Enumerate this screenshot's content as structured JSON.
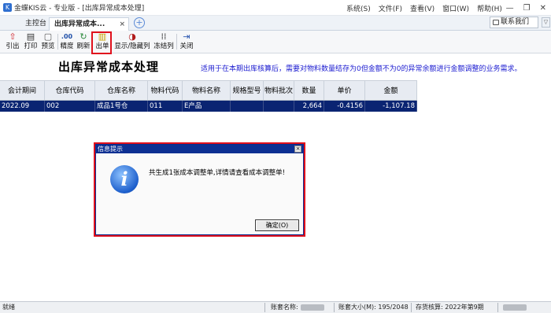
{
  "window": {
    "app_logo": "K",
    "title": "金蝶KIS云 - 专业版 - [出库异常成本处理]",
    "menus": [
      {
        "label": "系统(S)"
      },
      {
        "label": "文件(F)"
      },
      {
        "label": "查看(V)"
      },
      {
        "label": "窗口(W)"
      },
      {
        "label": "帮助(H)"
      }
    ],
    "controls": {
      "minimize": "—",
      "restore": "❐",
      "close": "✕"
    }
  },
  "tabs": {
    "main_label": "主控台",
    "active_label": "出库异常成本...",
    "close_glyph": "×",
    "add_glyph": "+"
  },
  "contact_label": "联系我们",
  "collapse_glyph": "▽",
  "toolbar": {
    "items": [
      {
        "icon": "⇧",
        "label": "引出",
        "color": "#d0242c"
      },
      {
        "icon": "▤",
        "label": "打印",
        "color": "#333"
      },
      {
        "icon": "▢",
        "label": "预览",
        "color": "#555"
      },
      {
        "icon": ".00",
        "label": "精度",
        "color": "#1f4fa8"
      },
      {
        "icon": "↻",
        "label": "刷新",
        "color": "#2c8a3c"
      },
      {
        "icon": "▥",
        "label": "出单",
        "color": "#c7a100"
      },
      {
        "icon": "◑",
        "label": "显示/隐藏列",
        "color": "#b11b1b"
      },
      {
        "icon": "⁞⁞",
        "label": "冻结列",
        "color": "#333"
      },
      {
        "icon": "⇥",
        "label": "关闭",
        "color": "#2a56b0"
      }
    ]
  },
  "page": {
    "title": "出库异常成本处理",
    "hint": "适用于在本期出库核算后，需要对物料数量结存为0但金额不为0的异常余额进行金额调整的业务需求。"
  },
  "table": {
    "columns": [
      "会计期间",
      "仓库代码",
      "仓库名称",
      "物料代码",
      "物料名称",
      "规格型号",
      "物料批次",
      "数量",
      "单价",
      "金额"
    ],
    "rows": [
      [
        "2022.09",
        "002",
        "成品1号仓",
        "011",
        "E产品",
        "",
        "",
        "2,664",
        "-0.4156",
        "-1,107.18"
      ]
    ]
  },
  "dialog": {
    "title": "信息提示",
    "close_glyph": "×",
    "icon_glyph": "i",
    "message": "共生成1张成本调整单,详情请查看成本调整单!",
    "ok_label": "确定(O)"
  },
  "statusbar": {
    "ready": "就绪",
    "account_label": "账套名称:",
    "size_label": "账套大小(M): 195/2048",
    "period_label": "存货核算: 2022年第9期"
  }
}
